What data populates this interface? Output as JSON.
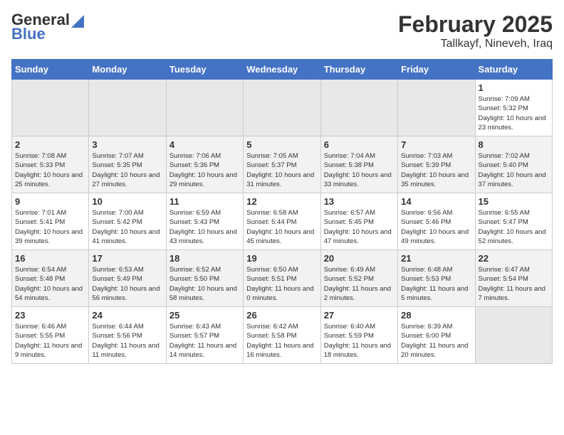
{
  "logo": {
    "general": "General",
    "blue": "Blue"
  },
  "title": "February 2025",
  "subtitle": "Tallkayf, Nineveh, Iraq",
  "days_of_week": [
    "Sunday",
    "Monday",
    "Tuesday",
    "Wednesday",
    "Thursday",
    "Friday",
    "Saturday"
  ],
  "weeks": [
    [
      {
        "day": "",
        "info": ""
      },
      {
        "day": "",
        "info": ""
      },
      {
        "day": "",
        "info": ""
      },
      {
        "day": "",
        "info": ""
      },
      {
        "day": "",
        "info": ""
      },
      {
        "day": "",
        "info": ""
      },
      {
        "day": "1",
        "info": "Sunrise: 7:09 AM\nSunset: 5:32 PM\nDaylight: 10 hours and 23 minutes."
      }
    ],
    [
      {
        "day": "2",
        "info": "Sunrise: 7:08 AM\nSunset: 5:33 PM\nDaylight: 10 hours and 25 minutes."
      },
      {
        "day": "3",
        "info": "Sunrise: 7:07 AM\nSunset: 5:35 PM\nDaylight: 10 hours and 27 minutes."
      },
      {
        "day": "4",
        "info": "Sunrise: 7:06 AM\nSunset: 5:36 PM\nDaylight: 10 hours and 29 minutes."
      },
      {
        "day": "5",
        "info": "Sunrise: 7:05 AM\nSunset: 5:37 PM\nDaylight: 10 hours and 31 minutes."
      },
      {
        "day": "6",
        "info": "Sunrise: 7:04 AM\nSunset: 5:38 PM\nDaylight: 10 hours and 33 minutes."
      },
      {
        "day": "7",
        "info": "Sunrise: 7:03 AM\nSunset: 5:39 PM\nDaylight: 10 hours and 35 minutes."
      },
      {
        "day": "8",
        "info": "Sunrise: 7:02 AM\nSunset: 5:40 PM\nDaylight: 10 hours and 37 minutes."
      }
    ],
    [
      {
        "day": "9",
        "info": "Sunrise: 7:01 AM\nSunset: 5:41 PM\nDaylight: 10 hours and 39 minutes."
      },
      {
        "day": "10",
        "info": "Sunrise: 7:00 AM\nSunset: 5:42 PM\nDaylight: 10 hours and 41 minutes."
      },
      {
        "day": "11",
        "info": "Sunrise: 6:59 AM\nSunset: 5:43 PM\nDaylight: 10 hours and 43 minutes."
      },
      {
        "day": "12",
        "info": "Sunrise: 6:58 AM\nSunset: 5:44 PM\nDaylight: 10 hours and 45 minutes."
      },
      {
        "day": "13",
        "info": "Sunrise: 6:57 AM\nSunset: 5:45 PM\nDaylight: 10 hours and 47 minutes."
      },
      {
        "day": "14",
        "info": "Sunrise: 6:56 AM\nSunset: 5:46 PM\nDaylight: 10 hours and 49 minutes."
      },
      {
        "day": "15",
        "info": "Sunrise: 6:55 AM\nSunset: 5:47 PM\nDaylight: 10 hours and 52 minutes."
      }
    ],
    [
      {
        "day": "16",
        "info": "Sunrise: 6:54 AM\nSunset: 5:48 PM\nDaylight: 10 hours and 54 minutes."
      },
      {
        "day": "17",
        "info": "Sunrise: 6:53 AM\nSunset: 5:49 PM\nDaylight: 10 hours and 56 minutes."
      },
      {
        "day": "18",
        "info": "Sunrise: 6:52 AM\nSunset: 5:50 PM\nDaylight: 10 hours and 58 minutes."
      },
      {
        "day": "19",
        "info": "Sunrise: 6:50 AM\nSunset: 5:51 PM\nDaylight: 11 hours and 0 minutes."
      },
      {
        "day": "20",
        "info": "Sunrise: 6:49 AM\nSunset: 5:52 PM\nDaylight: 11 hours and 2 minutes."
      },
      {
        "day": "21",
        "info": "Sunrise: 6:48 AM\nSunset: 5:53 PM\nDaylight: 11 hours and 5 minutes."
      },
      {
        "day": "22",
        "info": "Sunrise: 6:47 AM\nSunset: 5:54 PM\nDaylight: 11 hours and 7 minutes."
      }
    ],
    [
      {
        "day": "23",
        "info": "Sunrise: 6:46 AM\nSunset: 5:55 PM\nDaylight: 11 hours and 9 minutes."
      },
      {
        "day": "24",
        "info": "Sunrise: 6:44 AM\nSunset: 5:56 PM\nDaylight: 11 hours and 11 minutes."
      },
      {
        "day": "25",
        "info": "Sunrise: 6:43 AM\nSunset: 5:57 PM\nDaylight: 11 hours and 14 minutes."
      },
      {
        "day": "26",
        "info": "Sunrise: 6:42 AM\nSunset: 5:58 PM\nDaylight: 11 hours and 16 minutes."
      },
      {
        "day": "27",
        "info": "Sunrise: 6:40 AM\nSunset: 5:59 PM\nDaylight: 11 hours and 18 minutes."
      },
      {
        "day": "28",
        "info": "Sunrise: 6:39 AM\nSunset: 6:00 PM\nDaylight: 11 hours and 20 minutes."
      },
      {
        "day": "",
        "info": ""
      }
    ]
  ]
}
